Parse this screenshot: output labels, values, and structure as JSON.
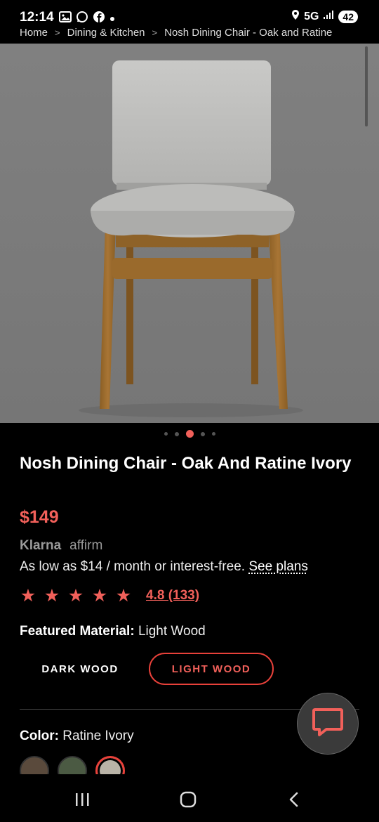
{
  "status_bar": {
    "time": "12:14",
    "left_icons": [
      "gallery-icon",
      "whatsapp-icon",
      "facebook-icon",
      "dot-icon"
    ],
    "network": "5G",
    "battery": "42"
  },
  "breadcrumb": {
    "items": [
      "Home",
      "Dining & Kitchen",
      "Nosh Dining Chair - Oak and Ratine"
    ]
  },
  "carousel": {
    "count": 5,
    "active_index": 2
  },
  "product": {
    "title": "Nosh Dining Chair - Oak And Ratine Ivory",
    "price": "$149"
  },
  "financing": {
    "klarna": "Klarna",
    "affirm": "affirm",
    "text": "As low as $14 / month or interest-free.",
    "link": "See plans"
  },
  "rating": {
    "stars": 5,
    "text": "4.8 (133)"
  },
  "material": {
    "label": "Featured Material:",
    "value": "Light Wood",
    "options": [
      "DARK WOOD",
      "LIGHT WOOD"
    ],
    "selected": "LIGHT WOOD"
  },
  "color": {
    "label": "Color:",
    "value": "Ratine Ivory",
    "swatch_colors": [
      "#5a4a3c",
      "#4b5a43",
      "#b9b3a7"
    ]
  },
  "theme": {
    "accent": "#f1605a",
    "background": "#000000"
  }
}
